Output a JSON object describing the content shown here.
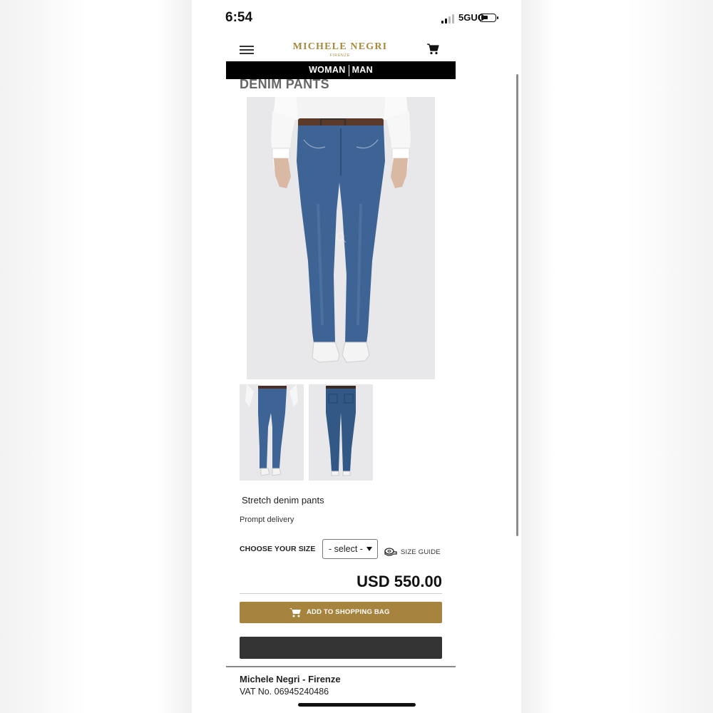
{
  "status_bar": {
    "time": "6:54",
    "network": "5GUC"
  },
  "header": {
    "logo_main": "MICHELE NEGRI",
    "logo_sub": "FIRENZE"
  },
  "nav": {
    "woman": "WOMAN",
    "man": "MAN"
  },
  "product": {
    "title": "DENIM PANTS",
    "description": "Stretch denim pants",
    "delivery": "Prompt delivery",
    "size_label": "CHOOSE YOUR SIZE",
    "size_value": "- select -",
    "size_guide": "SIZE GUIDE",
    "price": "USD 550.00",
    "add_to_bag": "ADD TO SHOPPING BAG"
  },
  "footer": {
    "company": "Michele Negri - Firenze",
    "vat": "VAT No. 06945240486"
  },
  "colors": {
    "brand_gold": "#a7843e",
    "nav_black": "#000000",
    "dark_button": "#333333"
  },
  "icons": [
    "menu-icon",
    "cart-icon",
    "zoom-icon",
    "ruler-icon"
  ]
}
